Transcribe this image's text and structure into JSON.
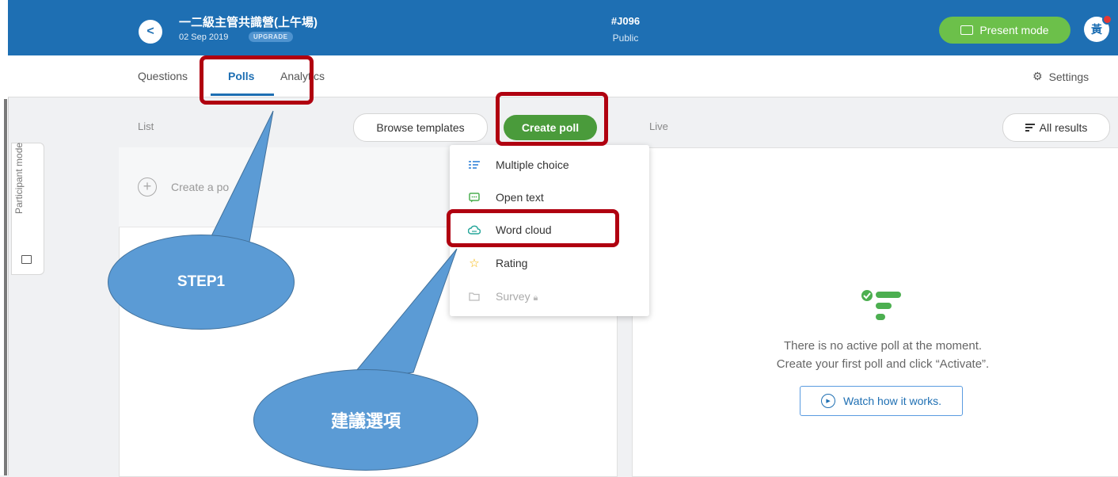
{
  "header": {
    "back_icon": "chevron-left",
    "title": "一二級主管共識營(上午場)",
    "date": "02 Sep 2019",
    "upgrade_badge": "UPGRADE",
    "event_code": "#J096",
    "visibility": "Public",
    "present_button": "Present mode",
    "avatar_initial": "黃"
  },
  "tabs": [
    {
      "label": "Questions"
    },
    {
      "label": "Polls",
      "active": true
    },
    {
      "label": "Analytics"
    }
  ],
  "settings_label": "Settings",
  "sidebar": {
    "participant_mode": "Participant mode"
  },
  "list": {
    "label": "List",
    "browse_button": "Browse templates",
    "create_button": "Create poll",
    "create_row_text": "Create a po"
  },
  "live": {
    "label": "Live",
    "all_results_button": "All results",
    "empty_line1": "There is no active poll at the moment.",
    "empty_line2": "Create your first poll and click “Activate”.",
    "watch_button": "Watch how it works."
  },
  "dropdown": {
    "items": [
      {
        "label": "Multiple choice",
        "icon": "list-icon"
      },
      {
        "label": "Open text",
        "icon": "chat-icon"
      },
      {
        "label": "Word cloud",
        "icon": "cloud-icon"
      },
      {
        "label": "Rating",
        "icon": "star-icon"
      },
      {
        "label": "Survey",
        "icon": "folder-icon",
        "disabled": true
      }
    ]
  },
  "annotations": {
    "step1": "STEP1",
    "suggested": "建議選項"
  },
  "colors": {
    "header_blue": "#1e6fb3",
    "green": "#4a9b3b",
    "present_green": "#6cc04a",
    "highlight_red": "#b00010",
    "callout_blue": "#5b9bd5"
  }
}
